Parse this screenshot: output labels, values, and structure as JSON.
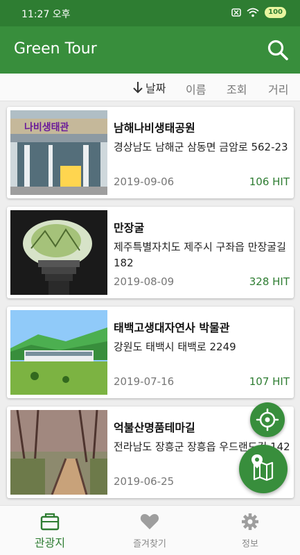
{
  "status_bar": {
    "time": "11:27 오후",
    "battery": "100"
  },
  "app_bar": {
    "title": "Green Tour",
    "icon": "search-icon"
  },
  "sort_options": [
    {
      "label": "날짜",
      "active": true
    },
    {
      "label": "이름"
    },
    {
      "label": "조회"
    },
    {
      "label": "거리"
    }
  ],
  "places": [
    {
      "name": "남해나비생태공원",
      "address": "경상남도 남해군 삼동면 금암로 562-23",
      "date": "2019-09-06",
      "hits": "106 HIT",
      "photo_sign": "나비생태관"
    },
    {
      "name": "만장굴",
      "address": "제주특별자치도 제주시 구좌읍 만장굴길 182",
      "date": "2019-08-09",
      "hits": "328 HIT"
    },
    {
      "name": "태백고생대자연사 박물관",
      "address": "강원도 태백시 태백로 2249",
      "date": "2019-07-16",
      "hits": "107 HIT"
    },
    {
      "name": "억불산명품테마길",
      "address": "전라남도 장흥군 장흥읍 우드랜드길 142",
      "date": "2019-06-25",
      "hits": ""
    }
  ],
  "fabs": {
    "locate_icon": "gps-target-icon",
    "map_icon": "map-icon"
  },
  "bottom_nav": [
    {
      "label": "관광지",
      "icon": "briefcase-icon",
      "active": true
    },
    {
      "label": "즐겨찾기",
      "icon": "heart-icon"
    },
    {
      "label": "정보",
      "icon": "gear-icon"
    }
  ],
  "colors": {
    "primary": "#388e3c",
    "primary_dark": "#2e7d32",
    "hit_text": "#2e7d32",
    "background": "#eeeeee"
  }
}
